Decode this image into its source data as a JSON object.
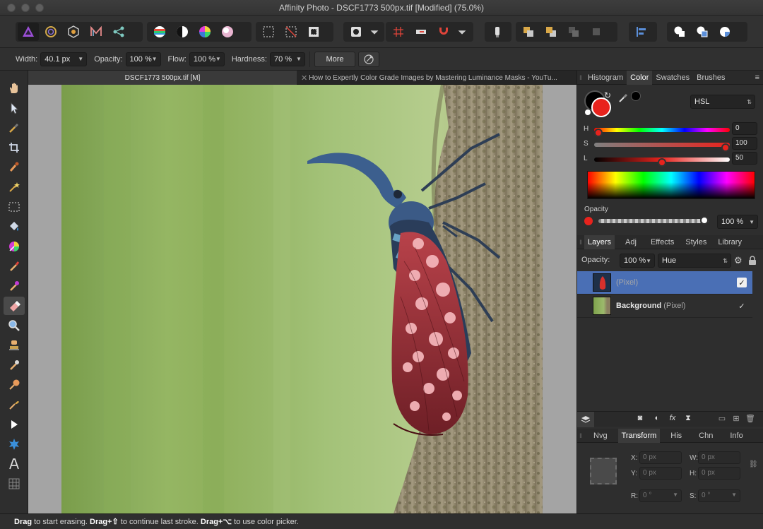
{
  "window": {
    "title": "Affinity Photo - DSCF1773 500px.tif [Modified] (75.0%)"
  },
  "context_bar": {
    "width_label": "Width:",
    "width_value": "40.1 px",
    "opacity_label": "Opacity:",
    "opacity_value": "100 %",
    "flow_label": "Flow:",
    "flow_value": "100 %",
    "hardness_label": "Hardness:",
    "hardness_value": "70 %",
    "more_label": "More"
  },
  "doc_tabs": [
    {
      "label": "DSCF1773 500px.tif [M]",
      "active": true
    },
    {
      "label": "How to Expertly Color Grade Images by Mastering Luminance Masks - YouTu...",
      "active": false
    }
  ],
  "color_panel": {
    "tabs": [
      "Histogram",
      "Color",
      "Swatches",
      "Brushes"
    ],
    "active_tab": "Color",
    "mode": "HSL",
    "primary_color": "#e8231d",
    "secondary_color": "#000000",
    "h_label": "H",
    "h_value": "0",
    "h_fraction": 0.0,
    "s_label": "S",
    "s_value": "100",
    "s_fraction": 1.0,
    "l_label": "L",
    "l_value": "50",
    "l_fraction": 0.5,
    "opacity_label": "Opacity",
    "opacity_value": "100 %",
    "opacity_fraction": 1.0
  },
  "layers_panel": {
    "tabs": [
      "Layers",
      "Adj",
      "Effects",
      "Styles",
      "Library"
    ],
    "active_tab": "Layers",
    "opacity_label": "Opacity:",
    "opacity_value": "100 %",
    "blend_mode": "Hue",
    "layers": [
      {
        "name": "",
        "type": "(Pixel)",
        "selected": true,
        "visible": true
      },
      {
        "name": "Background",
        "type": "(Pixel)",
        "selected": false,
        "visible": true
      }
    ]
  },
  "transform_panel": {
    "tabs": [
      "Nvg",
      "Transform",
      "His",
      "Chn",
      "Info"
    ],
    "active_tab": "Transform",
    "x_label": "X:",
    "x_value": "0 px",
    "y_label": "Y:",
    "y_value": "0 px",
    "w_label": "W:",
    "w_value": "0 px",
    "h_label": "H:",
    "h_value": "0 px",
    "r_label": "R:",
    "r_value": "0 °",
    "s_label": "S:",
    "s_value": "0 °"
  },
  "status_bar": {
    "part1_bold": "Drag",
    "part1": " to start erasing. ",
    "part2_bold": "Drag+⇧",
    "part2": " to continue last stroke. ",
    "part3_bold": "Drag+⌥",
    "part3": " to use color picker."
  },
  "colors": {
    "selection_blue": "#4a6fb5",
    "accent_red": "#e8231d"
  }
}
